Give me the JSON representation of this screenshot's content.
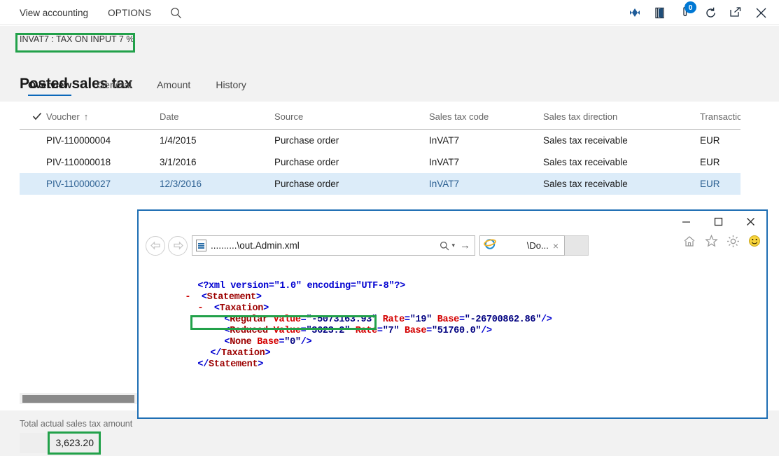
{
  "topbar": {
    "menu": [
      {
        "label": "View accounting",
        "name": "menu-view-accounting"
      },
      {
        "label": "OPTIONS",
        "name": "menu-options"
      }
    ],
    "search_icon": "search-icon",
    "right_icons": [
      {
        "name": "dynamics-diamond-icon",
        "glyph": "❖"
      },
      {
        "name": "office-app-icon",
        "glyph": "◧"
      },
      {
        "name": "notifications-icon",
        "glyph": "⚑",
        "badge": "0"
      },
      {
        "name": "refresh-icon",
        "glyph": "↻"
      },
      {
        "name": "popout-icon",
        "glyph": "↗"
      },
      {
        "name": "close-icon",
        "glyph": "✕"
      }
    ]
  },
  "header": {
    "caption": "INVAT7 : TAX ON INPUT 7 %",
    "title": "Posted sales tax"
  },
  "tabs": [
    {
      "label": "Overview",
      "active": true
    },
    {
      "label": "General",
      "active": false
    },
    {
      "label": "Amount",
      "active": false
    },
    {
      "label": "History",
      "active": false
    }
  ],
  "grid": {
    "columns": [
      {
        "label": "",
        "key": "check"
      },
      {
        "label": "Voucher",
        "key": "voucher",
        "sorted": "↑"
      },
      {
        "label": "Date",
        "key": "date"
      },
      {
        "label": "Source",
        "key": "source"
      },
      {
        "label": "Sales tax code",
        "key": "code"
      },
      {
        "label": "Sales tax direction",
        "key": "direction"
      },
      {
        "label": "Transaction",
        "key": "currency"
      }
    ],
    "rows": [
      {
        "voucher": "PIV-110000004",
        "date": "1/4/2015",
        "source": "Purchase order",
        "code": "InVAT7",
        "direction": "Sales tax receivable",
        "currency": "EUR",
        "selected": false
      },
      {
        "voucher": "PIV-110000018",
        "date": "3/1/2016",
        "source": "Purchase order",
        "code": "InVAT7",
        "direction": "Sales tax receivable",
        "currency": "EUR",
        "selected": false
      },
      {
        "voucher": "PIV-110000027",
        "date": "12/3/2016",
        "source": "Purchase order",
        "code": "InVAT7",
        "direction": "Sales tax receivable",
        "currency": "EUR",
        "selected": true
      }
    ]
  },
  "footer": {
    "total_label": "Total actual sales tax amount",
    "total_value": "3,623.20"
  },
  "browser": {
    "address": "..........\\out.Admin.xml",
    "tab_title": "\\Do...",
    "tab_close": "×",
    "search_glyph": "⌕",
    "dropdown_glyph": "▾",
    "go_glyph": "→",
    "back_glyph": "⇐",
    "forward_glyph": "⇒",
    "window_buttons": [
      {
        "name": "minimize-button",
        "glyph": "—"
      },
      {
        "name": "maximize-button",
        "glyph": "☐"
      },
      {
        "name": "close-button",
        "glyph": "✕"
      }
    ],
    "command_icons": [
      {
        "name": "home-icon",
        "glyph": "⌂"
      },
      {
        "name": "favorites-star-icon",
        "glyph": "☆"
      },
      {
        "name": "tools-gear-icon",
        "glyph": "⚙"
      },
      {
        "name": "smiley-feedback-icon",
        "glyph": "☺"
      }
    ],
    "xml": {
      "declaration": "<?xml version=\"1.0\" encoding=\"UTF-8\"?>",
      "lines": [
        {
          "indent": 0,
          "minus": false,
          "text": "<?xml version=\"1.0\" encoding=\"UTF-8\"?>",
          "kind": "decl"
        },
        {
          "indent": 0,
          "minus": true,
          "text": "<Statement>",
          "kind": "tag"
        },
        {
          "indent": 1,
          "minus": true,
          "text": "<Taxation>",
          "kind": "tag"
        },
        {
          "indent": 2,
          "minus": false,
          "tag": "Regular",
          "attrs": [
            [
              "Value",
              "-5073163.93"
            ],
            [
              "Rate",
              "19"
            ],
            [
              "Base",
              "-26700862.86"
            ]
          ],
          "kind": "element"
        },
        {
          "indent": 2,
          "minus": false,
          "tag": "Reduced",
          "attrs": [
            [
              "Value",
              "3623.2"
            ],
            [
              "Rate",
              "7"
            ],
            [
              "Base",
              "51760.0"
            ]
          ],
          "kind": "element"
        },
        {
          "indent": 2,
          "minus": false,
          "tag": "None",
          "attrs": [
            [
              "Base",
              "0"
            ]
          ],
          "kind": "element"
        },
        {
          "indent": 1,
          "minus": false,
          "text": "</Taxation>",
          "kind": "tag"
        },
        {
          "indent": 0,
          "minus": false,
          "text": "</Statement>",
          "kind": "tag"
        }
      ]
    }
  },
  "highlights": {
    "color": "#22a14a",
    "regions": [
      "header-caption",
      "xml-reduced-line",
      "total-value"
    ]
  }
}
